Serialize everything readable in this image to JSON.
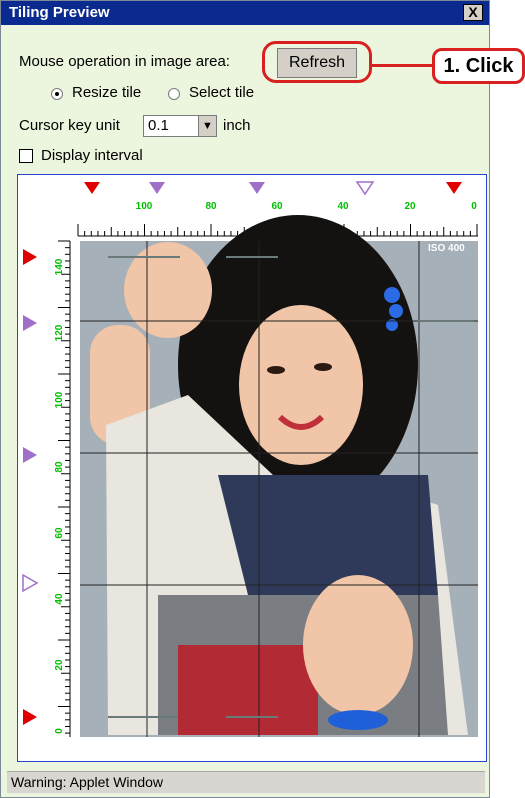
{
  "window": {
    "title": "Tiling Preview",
    "close_label": "X"
  },
  "controls": {
    "mouse_label": "Mouse operation in image area:",
    "refresh_label": "Refresh",
    "radio_resize_label": "Resize tile",
    "radio_select_label": "Select tile",
    "selected_mode": "Resize tile",
    "cursor_label": "Cursor key unit",
    "cursor_value": "0.1",
    "unit_label": "inch",
    "display_interval_label": "Display interval",
    "display_interval_checked": false
  },
  "preview": {
    "iso_label": "ISO 400",
    "top_ruler_labels": [
      "100",
      "80",
      "60",
      "40",
      "20",
      "0"
    ],
    "left_ruler_labels": [
      "140",
      "120",
      "100",
      "80",
      "60",
      "40",
      "20",
      "0"
    ],
    "top_markers": [
      {
        "color": "#e00000",
        "type": "filled"
      },
      {
        "color": "#a070c8",
        "type": "filled"
      },
      {
        "color": "#a070c8",
        "type": "filled"
      },
      {
        "color": "#a070c8",
        "type": "outline"
      },
      {
        "color": "#e00000",
        "type": "filled"
      }
    ],
    "left_markers": [
      {
        "color": "#e00000",
        "type": "filled"
      },
      {
        "color": "#a070c8",
        "type": "filled"
      },
      {
        "color": "#a070c8",
        "type": "filled"
      },
      {
        "color": "#a070c8",
        "type": "outline"
      },
      {
        "color": "#e00000",
        "type": "filled"
      }
    ]
  },
  "status_text": "Warning: Applet Window",
  "annotation": {
    "callout_text": "1. Click",
    "callout_color": "#d82020"
  },
  "colors": {
    "titlebar": "#0b2a8f",
    "panel_bg": "#ecf5dd",
    "preview_border": "#2a44d6",
    "ruler_labels": "#00c000"
  }
}
